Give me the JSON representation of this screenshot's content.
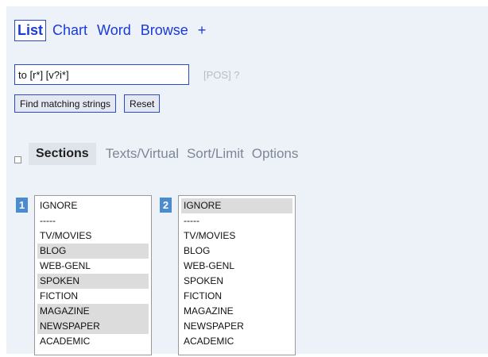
{
  "tabs": [
    {
      "label": "List",
      "active": true
    },
    {
      "label": "Chart",
      "active": false
    },
    {
      "label": "Word",
      "active": false
    },
    {
      "label": "Browse",
      "active": false
    },
    {
      "label": "+",
      "active": false
    }
  ],
  "search": {
    "value": "to [r*] [v?i*]",
    "pos_label": "[POS] ?"
  },
  "buttons": {
    "find": "Find matching strings",
    "reset": "Reset"
  },
  "sections_bar": {
    "checkbox_checked": false,
    "items": [
      {
        "label": "Sections",
        "active": true
      },
      {
        "label": "Texts/Virtual",
        "active": false
      },
      {
        "label": "Sort/Limit",
        "active": false
      },
      {
        "label": "Options",
        "active": false
      }
    ]
  },
  "lists": [
    {
      "number": "1",
      "options": [
        {
          "label": "IGNORE",
          "selected": false
        },
        {
          "label": "-----",
          "selected": false
        },
        {
          "label": "TV/MOVIES",
          "selected": false
        },
        {
          "label": "BLOG",
          "selected": true
        },
        {
          "label": "WEB-GENL",
          "selected": false
        },
        {
          "label": "SPOKEN",
          "selected": true
        },
        {
          "label": "FICTION",
          "selected": false
        },
        {
          "label": "MAGAZINE",
          "selected": true
        },
        {
          "label": "NEWSPAPER",
          "selected": true
        },
        {
          "label": "ACADEMIC",
          "selected": false
        }
      ]
    },
    {
      "number": "2",
      "options": [
        {
          "label": "IGNORE",
          "selected": true
        },
        {
          "label": "-----",
          "selected": false
        },
        {
          "label": "TV/MOVIES",
          "selected": false
        },
        {
          "label": "BLOG",
          "selected": false
        },
        {
          "label": "WEB-GENL",
          "selected": false
        },
        {
          "label": "SPOKEN",
          "selected": false
        },
        {
          "label": "FICTION",
          "selected": false
        },
        {
          "label": "MAGAZINE",
          "selected": false
        },
        {
          "label": "NEWSPAPER",
          "selected": false
        },
        {
          "label": "ACADEMIC",
          "selected": false
        }
      ]
    }
  ],
  "colors": {
    "panel_bg": "#edf1f8",
    "link": "#1a3bd6",
    "badge": "#4b8bd0",
    "selected_option": "#dcdcdc"
  }
}
